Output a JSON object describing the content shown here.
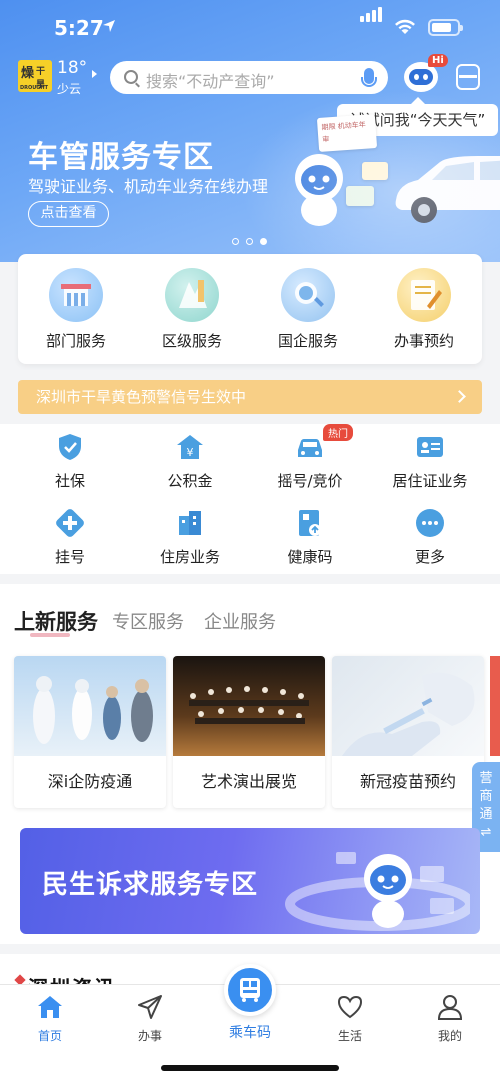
{
  "status_bar": {
    "time": "5:27"
  },
  "header": {
    "weather_badge_left": "燥",
    "weather_badge_right": "干旱",
    "weather_badge_bottom": "DROUGHT",
    "temperature": "18°",
    "weather": "少云",
    "search_placeholder": "搜索“不动产查询”",
    "assistant_badge": "Hi",
    "assistant_tooltip": "试试问我“今天天气”"
  },
  "banner": {
    "title": "车管服务专区",
    "subtitle": "驾驶证业务、机动车业务在线办理",
    "button": "点击查看",
    "doc_label": "期限 机动车年审"
  },
  "quick_services": [
    {
      "label": "部门服务",
      "icon": "department-icon"
    },
    {
      "label": "区级服务",
      "icon": "district-icon"
    },
    {
      "label": "国企服务",
      "icon": "soe-icon"
    },
    {
      "label": "办事预约",
      "icon": "appointment-icon"
    }
  ],
  "notice": {
    "text": "深圳市干旱黄色预警信号生效中"
  },
  "services": [
    {
      "label": "社保",
      "icon": "shield-check-icon"
    },
    {
      "label": "公积金",
      "icon": "house-yen-icon"
    },
    {
      "label": "摇号/竞价",
      "icon": "car-icon"
    },
    {
      "label": "居住证业务",
      "icon": "id-card-icon"
    },
    {
      "label": "挂号",
      "icon": "medical-cross-icon"
    },
    {
      "label": "住房业务",
      "icon": "building-icon"
    },
    {
      "label": "健康码",
      "icon": "health-code-icon"
    },
    {
      "label": "更多",
      "icon": "more-icon"
    }
  ],
  "hot_badge": "热门",
  "news_tabs": [
    "上新服务",
    "专区服务",
    "企业服务"
  ],
  "news_cards": [
    {
      "title": "深i企防疫通"
    },
    {
      "title": "艺术演出展览"
    },
    {
      "title": "新冠疫苗预约"
    }
  ],
  "side_tab": "营商通",
  "side_tab_arrow": "⇌",
  "mins_banner": {
    "title": "民生诉求服务专区"
  },
  "sz_news_title": "深圳资讯",
  "tabbar": [
    {
      "label": "首页",
      "icon": "home-icon",
      "active": true
    },
    {
      "label": "办事",
      "icon": "send-icon",
      "active": false
    },
    {
      "label": "乘车码",
      "icon": "bus-icon",
      "active": false
    },
    {
      "label": "生活",
      "icon": "heart-icon",
      "active": false
    },
    {
      "label": "我的",
      "icon": "person-icon",
      "active": false
    }
  ],
  "colors": {
    "primary": "#4e90f0",
    "accent": "#2f7de1",
    "notice": "#f8cf86",
    "hot": "#e74b3c"
  }
}
